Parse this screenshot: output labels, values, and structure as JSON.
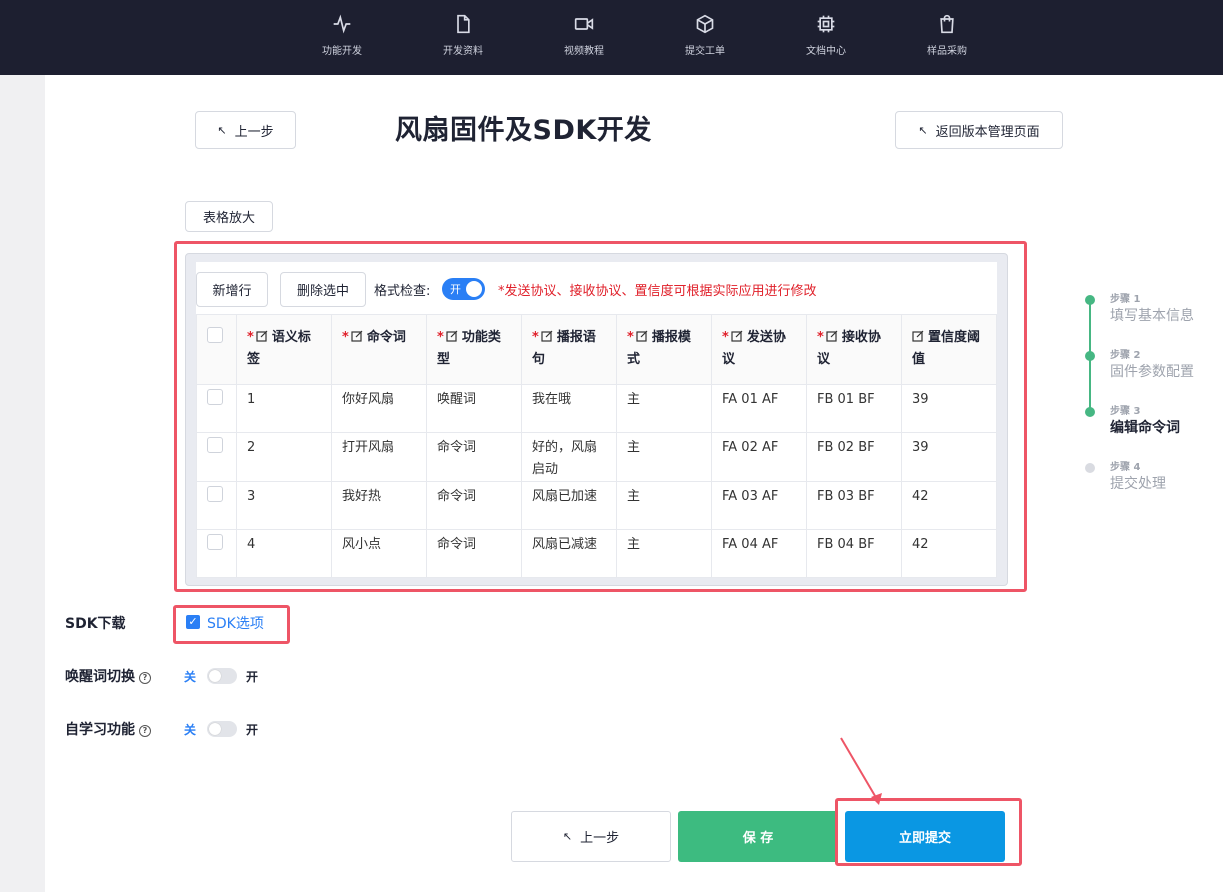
{
  "nav": {
    "items": [
      {
        "label": "功能开发",
        "icon": "activity-icon"
      },
      {
        "label": "开发资料",
        "icon": "file-icon"
      },
      {
        "label": "视频教程",
        "icon": "video-icon"
      },
      {
        "label": "提交工单",
        "icon": "box-icon"
      },
      {
        "label": "文档中心",
        "icon": "chip-icon"
      },
      {
        "label": "样品采购",
        "icon": "shopping-bag-icon"
      }
    ]
  },
  "header": {
    "prev_label": "上一步",
    "title": "风扇固件及SDK开发",
    "back_label": "返回版本管理页面"
  },
  "enlarge_label": "表格放大",
  "toolbar": {
    "add_row": "新增行",
    "delete_selected": "删除选中",
    "format_check_label": "格式检查:",
    "format_toggle_text": "开",
    "hint": "*发送协议、接收协议、置信度可根据实际应用进行修改"
  },
  "table": {
    "columns": [
      {
        "label": "语义标签",
        "required": true
      },
      {
        "label": "命令词",
        "required": true
      },
      {
        "label": "功能类型",
        "required": true
      },
      {
        "label": "播报语句",
        "required": true
      },
      {
        "label": "播报模式",
        "required": true
      },
      {
        "label": "发送协议",
        "required": true
      },
      {
        "label": "接收协议",
        "required": true
      },
      {
        "label": "置信度阈值",
        "required": false
      }
    ],
    "rows": [
      [
        "1",
        "你好风扇",
        "唤醒词",
        "我在哦",
        "主",
        "FA 01 AF",
        "FB 01 BF",
        "39"
      ],
      [
        "2",
        "打开风扇",
        "命令词",
        "好的，风扇启动",
        "主",
        "FA 02 AF",
        "FB 02 BF",
        "39"
      ],
      [
        "3",
        "我好热",
        "命令词",
        "风扇已加速",
        "主",
        "FA 03 AF",
        "FB 03 BF",
        "42"
      ],
      [
        "4",
        "风小点",
        "命令词",
        "风扇已减速",
        "主",
        "FA 04 AF",
        "FB 04 BF",
        "42"
      ]
    ]
  },
  "steps": [
    {
      "num": "步骤 1",
      "name": "填写基本信息",
      "state": "done"
    },
    {
      "num": "步骤 2",
      "name": "固件参数配置",
      "state": "done"
    },
    {
      "num": "步骤 3",
      "name": "编辑命令词",
      "state": "active"
    },
    {
      "num": "步骤 4",
      "name": "提交处理",
      "state": "pending"
    }
  ],
  "form": {
    "sdk_download_label": "SDK下载",
    "sdk_option_label": "SDK选项",
    "sdk_option_checked": true,
    "wake_switch_label": "唤醒词切换",
    "self_learning_label": "自学习功能",
    "off_label": "关",
    "on_label": "开",
    "wake_switch_on": false,
    "self_learning_on": false
  },
  "footer": {
    "prev_label": "上一步",
    "save_label": "保 存",
    "submit_label": "立即提交"
  },
  "colors": {
    "nav_bg": "#1d1f30",
    "accent_blue": "#2a7ff5",
    "save_green": "#3dbb80",
    "submit_blue": "#0a97e3",
    "highlight_red": "#ee5566",
    "step_green": "#46b783"
  }
}
